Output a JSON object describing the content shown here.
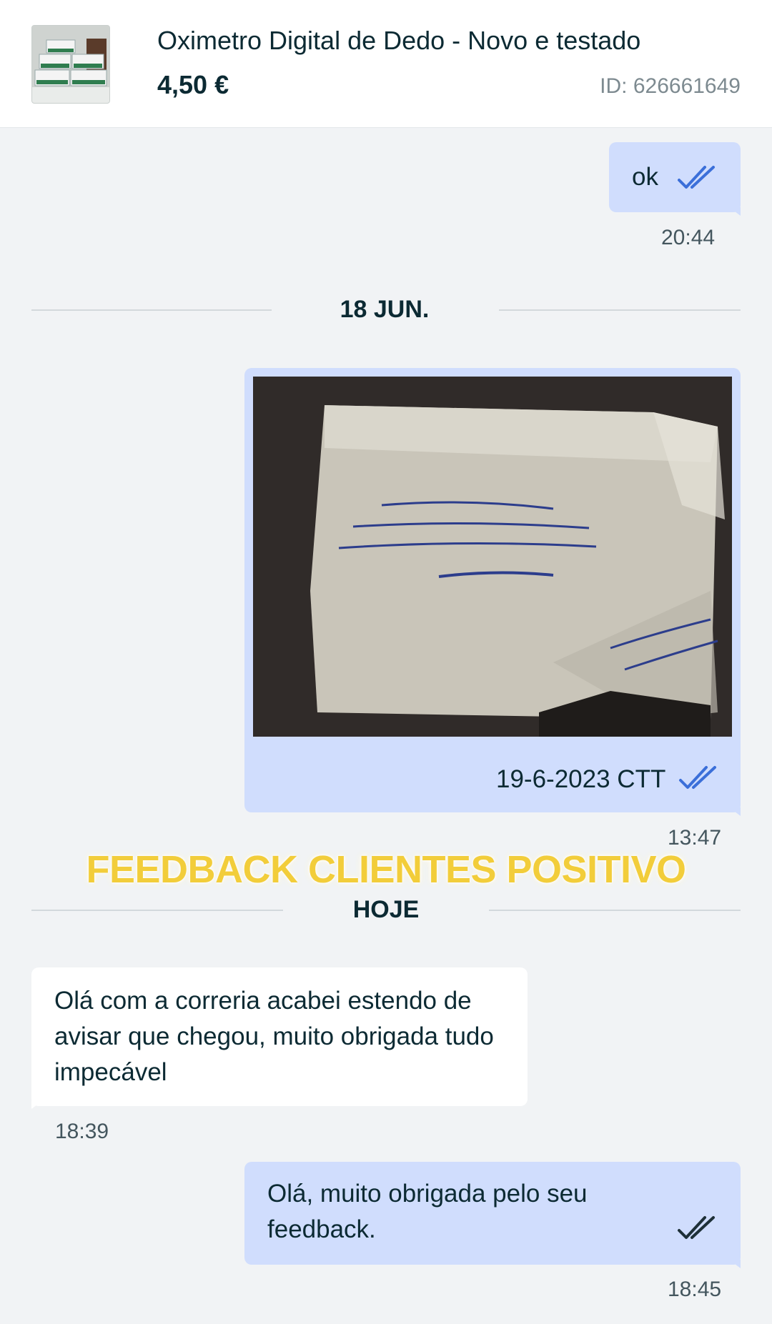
{
  "header": {
    "title": "Oximetro Digital de Dedo - Novo e testado",
    "price": "4,50 €",
    "id_label": "ID: 626661649"
  },
  "messages": {
    "ok_text": "ok",
    "ok_time": "20:44",
    "divider_1": "18 JUN.",
    "photo_caption": "19-6-2023 CTT",
    "photo_time": "13:47",
    "overlay_text": "FEEDBACK CLIENTES POSITIVO",
    "divider_2": "HOJE",
    "incoming_text": "Olá com a correria acabei estendo de avisar que chegou, muito obrigada tudo impecável",
    "incoming_time": "18:39",
    "reply_text": "Olá, muito obrigada pelo seu feedback.",
    "reply_time": "18:45"
  },
  "colors": {
    "outgoing_bubble": "#d0ddfd",
    "incoming_bubble": "#ffffff",
    "read_tick": "#3b6fd9",
    "overlay_yellow": "#f2cd3a"
  },
  "icons": {
    "read_tick_blue": "double-check-icon",
    "read_tick_dark": "double-check-icon"
  }
}
